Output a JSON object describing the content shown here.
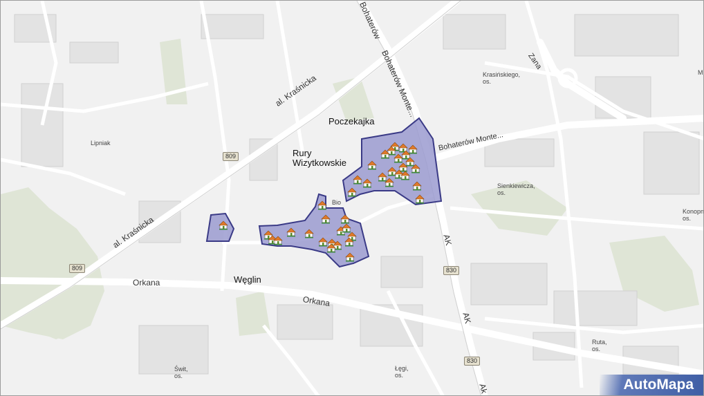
{
  "map": {
    "area_labels": {
      "poczekajka": "Poczekajka",
      "rury_1": "Rury",
      "rury_2": "Wizytkowskie",
      "weglin": "Węglin",
      "lipniak": "Lipniak",
      "krasinskiego_1": "Krasińskiego,",
      "krasinskiego_2": "os.",
      "sienkiewicza_1": "Sienkiewicza,",
      "sienkiewicza_2": "os.",
      "konopnickiej_1": "Konopn",
      "konopnickiej_2": "os.",
      "ruta_1": "Ruta,",
      "ruta_2": "os.",
      "legi_1": "Łęgi,",
      "legi_2": "os.",
      "swit_1": "Świt,",
      "swit_2": "os.",
      "bion": "Bio",
      "edge_m": "M"
    },
    "road_labels": {
      "krasnicka_1": "al. Kraśnicka",
      "krasnicka_2": "al. Kraśnicka",
      "bohaterow_top": "Bohaterów",
      "bohaterow_diag": "Bohaterów Monte...",
      "bohaterow_h": "Bohaterów Monte...",
      "zana": "Zana",
      "orkana_1": "Orkana",
      "orkana_2": "Orkana",
      "ak_1": "AK",
      "ak_2": "AK",
      "ak_3": "Ak"
    },
    "route_shields": [
      "809",
      "809",
      "830",
      "830"
    ],
    "highlight_color": "#9b9bd0",
    "marker_icon": "house-icon",
    "brand": "AutoMapa"
  }
}
